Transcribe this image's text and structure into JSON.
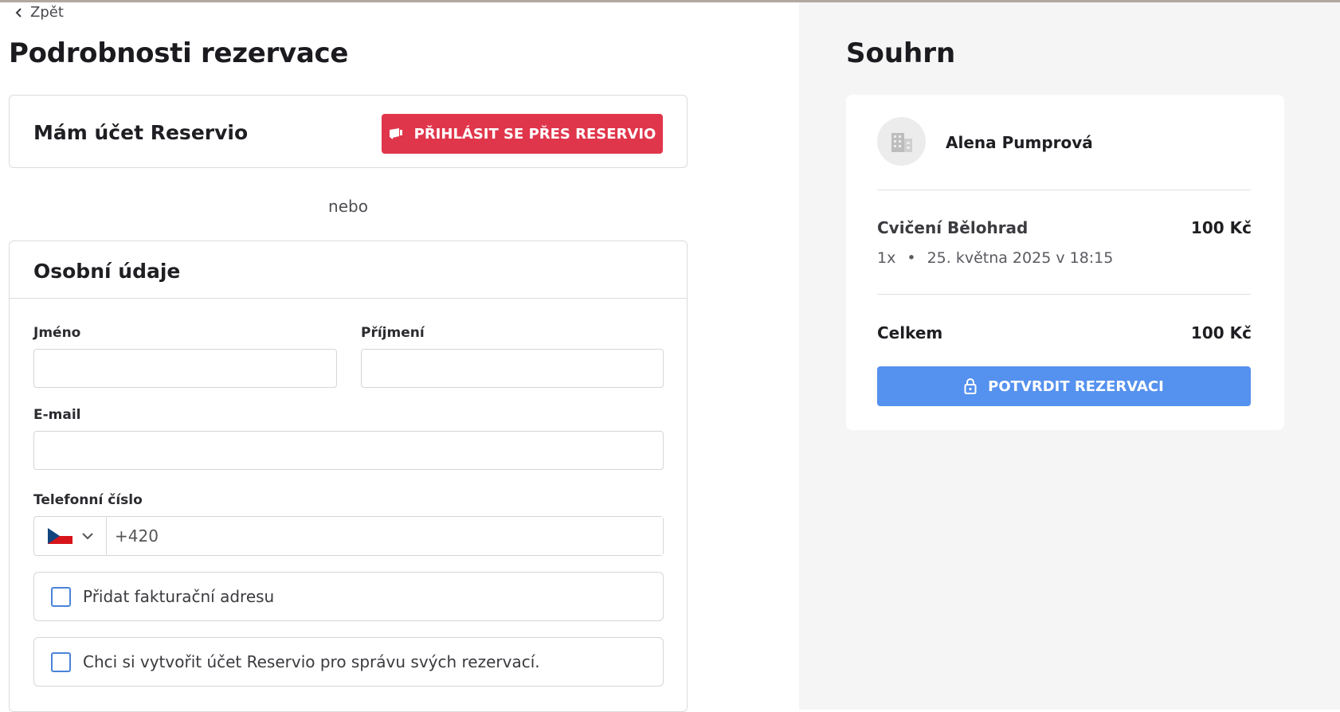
{
  "nav": {
    "back_label": "Zpět"
  },
  "page": {
    "title": "Podrobnosti rezervace"
  },
  "login_card": {
    "title": "Mám účet Reservio",
    "button_label": "PŘIHLÁSIT SE PŘES RESERVIO"
  },
  "or_text": "nebo",
  "personal": {
    "title": "Osobní údaje",
    "first_name_label": "Jméno",
    "first_name_value": "",
    "last_name_label": "Příjmení",
    "last_name_value": "",
    "email_label": "E-mail",
    "email_value": "",
    "phone_label": "Telefonní číslo",
    "phone_country": "CZ",
    "phone_value": "+420",
    "billing_checkbox_label": "Přidat fakturační adresu",
    "billing_checked": false,
    "account_checkbox_label": "Chci si vytvořit účet Reservio pro správu svých rezervací.",
    "account_checked": false
  },
  "summary": {
    "title": "Souhrn",
    "business_name": "Alena Pumprová",
    "service_name": "Cvičení Bělohrad",
    "service_price": "100 Kč",
    "quantity": "1x",
    "bullet": "•",
    "date_time": "25. května 2025 v 18:15",
    "total_label": "Celkem",
    "total_price": "100 Kč",
    "confirm_button_label": "POTVRDIT REZERVACI"
  },
  "colors": {
    "login_button": "#e0364b",
    "confirm_button": "#5591ee",
    "checkbox_border": "#4b83d8",
    "summary_background": "#f5f5f5"
  }
}
